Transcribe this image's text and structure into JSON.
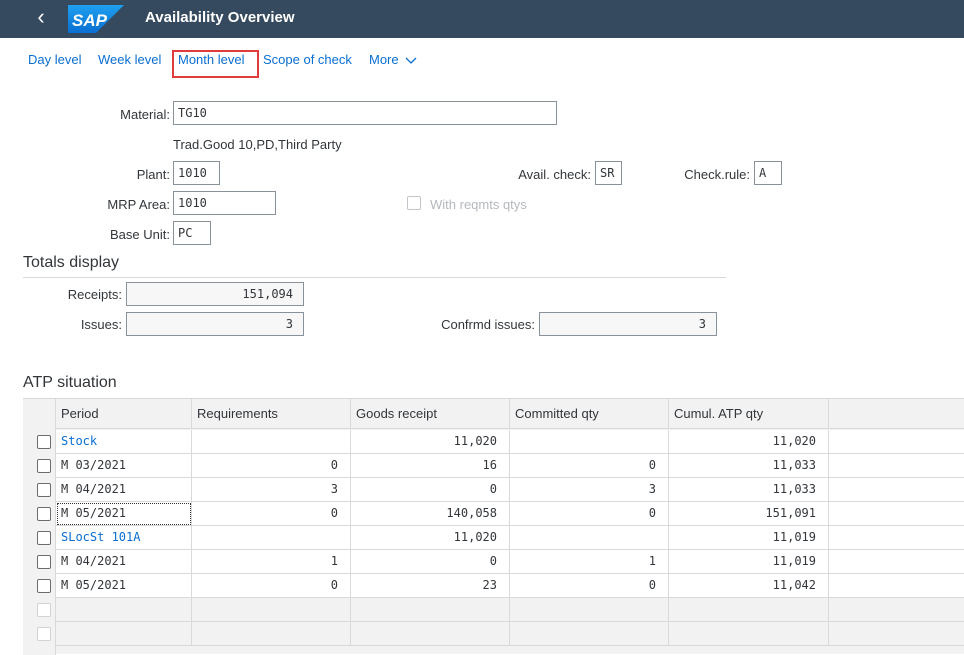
{
  "shell": {
    "back_icon": "chevron-left-icon",
    "logo_text": "SAP",
    "title": "Availability Overview",
    "color": "#354a5f"
  },
  "toolbar": {
    "day_level": "Day level",
    "week_level": "Week level",
    "month_level": "Month level",
    "scope_of_check": "Scope of check",
    "more": "More",
    "more_icon": "chevron-down-icon",
    "highlight_color": "#e03c3c"
  },
  "header": {
    "material_label": "Material:",
    "material_value": "TG10",
    "material_desc": "Trad.Good 10,PD,Third Party",
    "plant_label": "Plant:",
    "plant_value": "1010",
    "mrp_area_label": "MRP Area:",
    "mrp_area_value": "1010",
    "base_unit_label": "Base Unit:",
    "base_unit_value": "PC",
    "avail_check_label": "Avail. check:",
    "avail_check_value": "SR",
    "check_rule_label": "Check.rule:",
    "check_rule_value": "A",
    "with_reqmts_label": "With reqmts qtys"
  },
  "totals": {
    "title": "Totals display",
    "receipts_label": "Receipts:",
    "receipts_value": "151,094",
    "issues_label": "Issues:",
    "issues_value": "3",
    "confrmd_issues_label": "Confrmd issues:",
    "confrmd_issues_value": "3"
  },
  "atp": {
    "title": "ATP situation",
    "columns": [
      "Period",
      "Requirements",
      "Goods receipt",
      "Committed qty",
      "Cumul. ATP qty"
    ],
    "rows": [
      {
        "period": "Stock",
        "requirements": "",
        "goods_receipt": "11,020",
        "committed": "",
        "cumul": "11,020"
      },
      {
        "period": "M 03/2021",
        "requirements": "0",
        "goods_receipt": "16",
        "committed": "0",
        "cumul": "11,033"
      },
      {
        "period": "M 04/2021",
        "requirements": "3",
        "goods_receipt": "0",
        "committed": "3",
        "cumul": "11,033"
      },
      {
        "period": "M 05/2021",
        "requirements": "0",
        "goods_receipt": "140,058",
        "committed": "0",
        "cumul": "151,091"
      },
      {
        "period": "SLocSt  101A",
        "requirements": "",
        "goods_receipt": "11,020",
        "committed": "",
        "cumul": "11,019"
      },
      {
        "period": "M 04/2021",
        "requirements": "1",
        "goods_receipt": "0",
        "committed": "1",
        "cumul": "11,019"
      },
      {
        "period": "M 05/2021",
        "requirements": "0",
        "goods_receipt": "23",
        "committed": "0",
        "cumul": "11,042"
      }
    ]
  }
}
